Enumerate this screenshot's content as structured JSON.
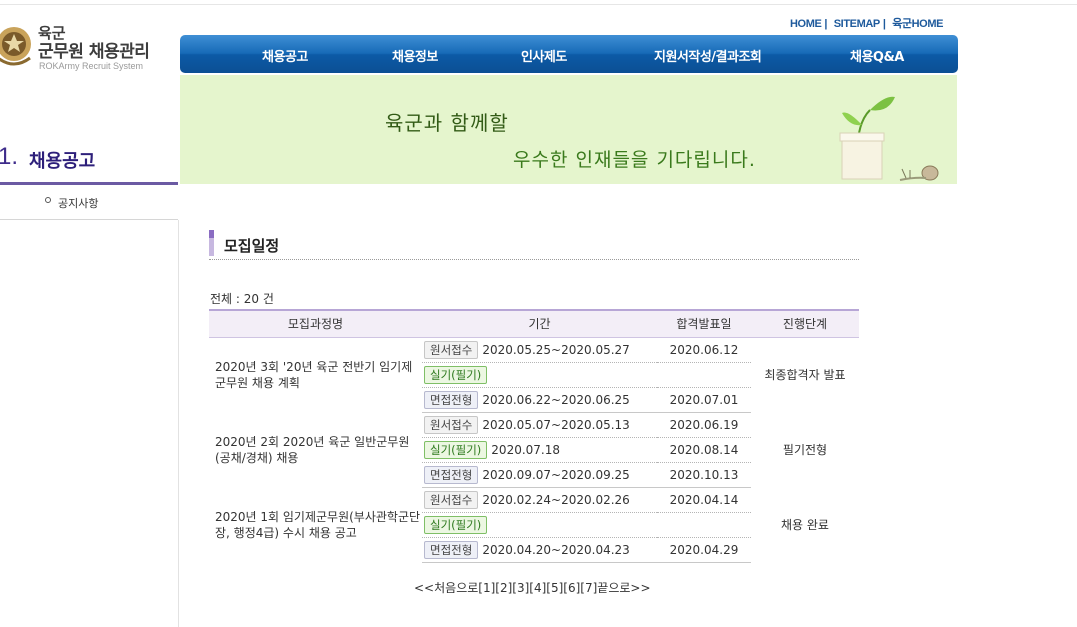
{
  "logo": {
    "line1": "육군",
    "line2": "군무원 채용관리",
    "sub": "ROKArmy Recruit System"
  },
  "util": {
    "home": "HOME",
    "sitemap": "SITEMAP",
    "army_home": "육군HOME",
    "separator": "|"
  },
  "nav": [
    "채용공고",
    "채용정보",
    "인사제도",
    "지원서작성/결과조회",
    "채용Q&A"
  ],
  "banner": {
    "line1": "육군과 함께할",
    "line2": "우수한  인재들을 기다립니다."
  },
  "sidebar": {
    "num": "1.",
    "title": "채용공고",
    "items": [
      {
        "label": "공지사항"
      }
    ]
  },
  "content": {
    "title": "모집일정",
    "total": "전체 : 20 건",
    "columns": [
      "모집과정명",
      "기간",
      "합격발표일",
      "진행단계"
    ],
    "rows": [
      {
        "name": "2020년 3회 '20년 육군 전반기 임기제군무원 채용 계획",
        "stage": "최종합격자 발표",
        "steps": [
          {
            "badge": "원서접수",
            "period": "2020.05.25~2020.05.27",
            "announce": "2020.06.12"
          },
          {
            "badge": "실기(필기)",
            "period": "",
            "announce": ""
          },
          {
            "badge": "면접전형",
            "period": "2020.06.22~2020.06.25",
            "announce": "2020.07.01"
          }
        ]
      },
      {
        "name": "2020년 2회 2020년 육군 일반군무원(공채/경채) 채용",
        "stage": "필기전형",
        "steps": [
          {
            "badge": "원서접수",
            "period": "2020.05.07~2020.05.13",
            "announce": "2020.06.19"
          },
          {
            "badge": "실기(필기)",
            "period": "2020.07.18",
            "announce": "2020.08.14"
          },
          {
            "badge": "면접전형",
            "period": "2020.09.07~2020.09.25",
            "announce": "2020.10.13"
          }
        ]
      },
      {
        "name": "2020년 1회 임기제군무원(부사관학군단장, 행정4급) 수시 채용 공고",
        "stage": "채용 완료",
        "steps": [
          {
            "badge": "원서접수",
            "period": "2020.02.24~2020.02.26",
            "announce": "2020.04.14"
          },
          {
            "badge": "실기(필기)",
            "period": "",
            "announce": ""
          },
          {
            "badge": "면접전형",
            "period": "2020.04.20~2020.04.23",
            "announce": "2020.04.29"
          }
        ]
      }
    ]
  },
  "pagination": {
    "first": "<<처음으로",
    "pages": [
      "[1]",
      "[2]",
      "[3]",
      "[4]",
      "[5]",
      "[6]",
      "[7]"
    ],
    "last": "끝으로>>"
  },
  "colors": {
    "nav_blue": "#1a6ab6",
    "banner_green": "#e5f5cd",
    "sidebar_purple": "#6b5aa3",
    "exam_badge": "#7fbf66"
  }
}
